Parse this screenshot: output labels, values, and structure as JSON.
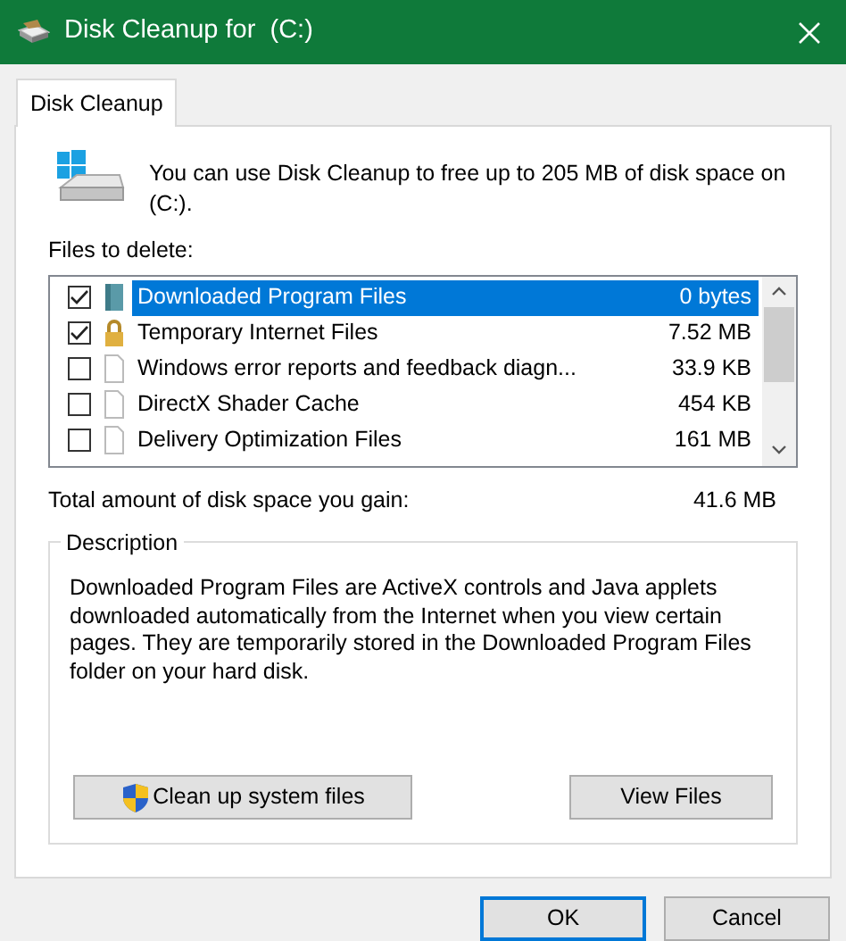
{
  "window": {
    "title": "Disk Cleanup for  (C:)"
  },
  "tabs": [
    {
      "label": "Disk Cleanup",
      "selected": true
    }
  ],
  "intro": "You can use Disk Cleanup to free up to 205 MB of disk space on (C:).",
  "files_label": "Files to delete:",
  "files": [
    {
      "name": "Downloaded Program Files",
      "size": "0 bytes",
      "checked": true,
      "selected": true,
      "kind": "program"
    },
    {
      "name": "Temporary Internet Files",
      "size": "7.52 MB",
      "checked": true,
      "selected": false,
      "kind": "lock"
    },
    {
      "name": "Windows error reports and feedback diagn...",
      "size": "33.9 KB",
      "checked": false,
      "selected": false,
      "kind": "file"
    },
    {
      "name": "DirectX Shader Cache",
      "size": "454 KB",
      "checked": false,
      "selected": false,
      "kind": "file"
    },
    {
      "name": "Delivery Optimization Files",
      "size": "161 MB",
      "checked": false,
      "selected": false,
      "kind": "file"
    }
  ],
  "total": {
    "label": "Total amount of disk space you gain:",
    "value": "41.6 MB"
  },
  "description": {
    "title": "Description",
    "text": "Downloaded Program Files are ActiveX controls and Java applets downloaded automatically from the Internet when you view certain pages. They are temporarily stored in the Downloaded Program Files folder on your hard disk."
  },
  "panel_buttons": [
    {
      "label": "Clean up system files",
      "shield": true
    },
    {
      "label": "View Files",
      "shield": false
    }
  ],
  "buttons": [
    {
      "label": "OK",
      "default": true
    },
    {
      "label": "Cancel",
      "default": false
    }
  ]
}
